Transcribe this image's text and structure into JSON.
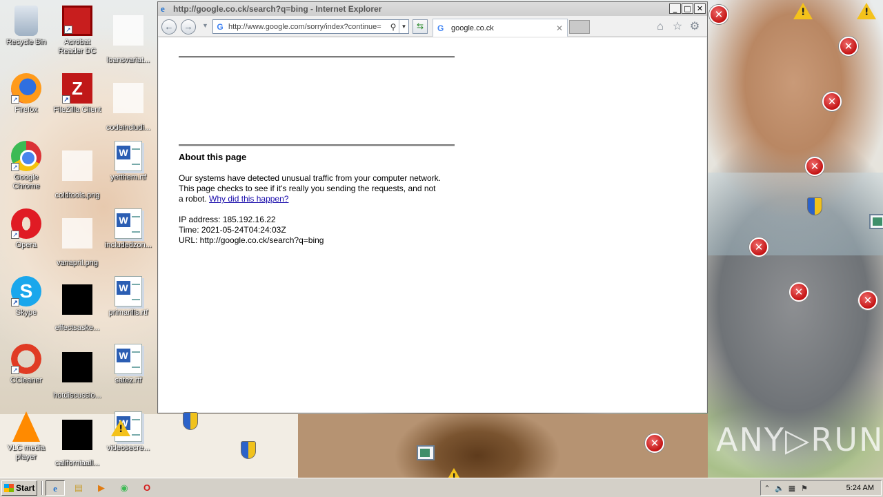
{
  "desktop": {
    "col1": [
      {
        "label": "Recycle Bin",
        "icon": "recycle-bin-icon"
      },
      {
        "label": "Firefox",
        "icon": "firefox-icon"
      },
      {
        "label": "Google Chrome",
        "icon": "chrome-icon"
      },
      {
        "label": "Opera",
        "icon": "opera-icon"
      },
      {
        "label": "Skype",
        "icon": "skype-icon"
      },
      {
        "label": "CCleaner",
        "icon": "ccleaner-icon"
      },
      {
        "label": "VLC media player",
        "icon": "vlc-icon"
      }
    ],
    "col2": [
      {
        "label": "Acrobat Reader DC",
        "icon": "acrobat-icon"
      },
      {
        "label": "FileZilla Client",
        "icon": "filezilla-icon"
      },
      {
        "label": "coldtools.png",
        "icon": "image-file-icon"
      },
      {
        "label": "vanapril.png",
        "icon": "image-file-icon"
      },
      {
        "label": "effectsaske...",
        "icon": "black-file-icon"
      },
      {
        "label": "hotdiscussio...",
        "icon": "black-file-icon"
      },
      {
        "label": "californiaall...",
        "icon": "black-file-icon"
      }
    ],
    "col3": [
      {
        "label": "loansvariat...",
        "icon": "blank-file-icon"
      },
      {
        "label": "codeincludi...",
        "icon": "blank-file-icon"
      },
      {
        "label": "yetthem.rtf",
        "icon": "word-doc-icon"
      },
      {
        "label": "includedzon...",
        "icon": "word-doc-icon"
      },
      {
        "label": "primarilis.rtf",
        "icon": "word-doc-icon"
      },
      {
        "label": "satez.rtf",
        "icon": "word-doc-icon"
      },
      {
        "label": "videosecre...",
        "icon": "word-doc-icon"
      }
    ]
  },
  "browser": {
    "title": "http://google.co.ck/search?q=bing - Internet Explorer",
    "address_url": "http://www.google.com/sorry/index?continue=",
    "tab_label": "google.co.ck",
    "page": {
      "heading": "About this page",
      "body_text": "Our systems have detected unusual traffic from your computer network. This page checks to see if it's really you sending the requests, and not a robot.",
      "link_text": "Why did this happen?",
      "ip_line": "IP address: 185.192.16.22",
      "time_line": "Time: 2021-05-24T04:24:03Z",
      "url_line": "URL: http://google.co.ck/search?q=bing"
    }
  },
  "taskbar": {
    "start_label": "Start",
    "clock": "5:24 AM"
  },
  "watermark": "ANY▷RUN",
  "colors": {
    "link": "#1a0dab",
    "error_red": "#c41414",
    "warning_yellow": "#f4c21b"
  }
}
